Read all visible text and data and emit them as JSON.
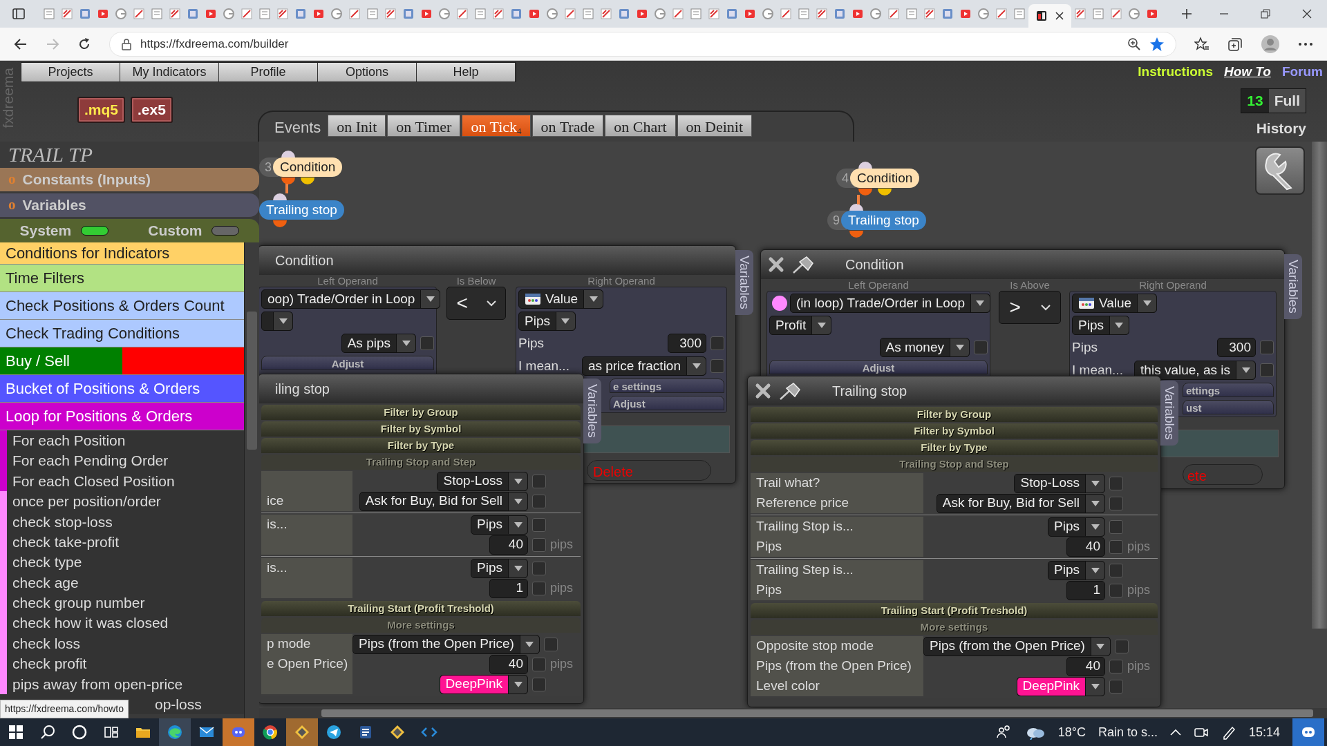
{
  "browser": {
    "url": "https://fxdreema.com/builder"
  },
  "logo": "fxdreema",
  "menu": [
    "Projects",
    "My Indicators",
    "Profile",
    "Options",
    "Help"
  ],
  "help_links": [
    {
      "label": "Instructions",
      "kind": "highlight"
    },
    {
      "label": "How To",
      "kind": "emphasis"
    },
    {
      "label": "Forum",
      "kind": "plain"
    }
  ],
  "export_buttons": [
    {
      "label": ".mq5",
      "kind": "source"
    },
    {
      "label": ".ex5",
      "kind": "compiled"
    }
  ],
  "events": {
    "label": "Events",
    "tabs": [
      {
        "label": "on Init",
        "selected": false
      },
      {
        "label": "on Timer",
        "selected": false
      },
      {
        "label": "on Tick",
        "selected": true,
        "count": "4"
      },
      {
        "label": "on Trade",
        "selected": false
      },
      {
        "label": "on Chart",
        "selected": false
      },
      {
        "label": "on Deinit",
        "selected": false
      }
    ]
  },
  "plan": {
    "count": "13",
    "label": "Full",
    "history": "History"
  },
  "project_title": "TRAIL TP",
  "sidebar": {
    "sections": [
      {
        "marker": "o",
        "label": "Constants (Inputs)",
        "color": "#9a7656"
      },
      {
        "marker": "o",
        "label": "Variables",
        "color": "#525264"
      }
    ],
    "toggles": [
      {
        "label": "System",
        "on": true
      },
      {
        "label": "Custom",
        "on": false
      }
    ],
    "categories": [
      {
        "label": "Conditions for Indicators",
        "color": "#ffd166"
      },
      {
        "label": "Time Filters",
        "color": "#b2e283"
      },
      {
        "label": "Check Positions & Orders Count",
        "color": "#adc9ff"
      },
      {
        "label": "Check Trading Conditions",
        "color": "#adc9ff"
      },
      {
        "label": "Buy / Sell",
        "color": "#008000",
        "sell": {
          "color": "#ff0000"
        }
      },
      {
        "label": "Bucket of Positions & Orders",
        "color": "#5555ff"
      },
      {
        "label": "Loop for Positions & Orders",
        "color": "#cc00cc"
      }
    ],
    "items": [
      {
        "label": "For each Position",
        "color": "#cc00cc"
      },
      {
        "label": "For each Pending Order",
        "color": "#cc00cc"
      },
      {
        "label": "For each Closed Position",
        "color": "#cc00cc"
      },
      {
        "label": "once per position/order",
        "color": "#ff88ff"
      },
      {
        "label": "check stop-loss",
        "color": "#ff88ff"
      },
      {
        "label": "check take-profit",
        "color": "#ff88ff"
      },
      {
        "label": "check type",
        "color": "#ff88ff"
      },
      {
        "label": "check age",
        "color": "#ff88ff"
      },
      {
        "label": "check group number",
        "color": "#ff88ff"
      },
      {
        "label": "check how it was closed",
        "color": "#ff88ff"
      },
      {
        "label": "check loss",
        "color": "#ff88ff"
      },
      {
        "label": "check profit",
        "color": "#ff88ff"
      },
      {
        "label": "pips away from open-price",
        "color": "#ff88ff"
      },
      {
        "label": "op-loss"
      }
    ]
  },
  "nodes": [
    {
      "number": "3",
      "label": "Condition",
      "kind": "condition"
    },
    {
      "label": "Trailing stop",
      "kind": "action"
    },
    {
      "number": "4",
      "label": "Condition",
      "kind": "condition"
    },
    {
      "number": "9",
      "label": "Trailing stop",
      "kind": "action"
    }
  ],
  "condition_windows": [
    {
      "title": "Condition",
      "controls": false,
      "left_label": "Left Operand",
      "operator_label": "Is Below",
      "right_label": "Right Operand",
      "source": {
        "text": "oop) Trade/Order in Loop"
      },
      "mode": "As pips",
      "mode_checked": false,
      "adjust": "Adjust",
      "operator": "<",
      "right_source": "Value",
      "unit": "Pips",
      "value_label": "Pips",
      "value": "300",
      "value_checked": false,
      "mean_label": "I mean...",
      "mean": "as price fraction",
      "mean_checked": false,
      "more_settings": "e settings",
      "right_adjust": "Adjust",
      "delete": "Delete",
      "variables_tab": "Variables"
    },
    {
      "title": "Condition",
      "controls": true,
      "left_label": "Left Operand",
      "operator_label": "Is Above",
      "right_label": "Right Operand",
      "source": {
        "text": "(in loop) Trade/Order in Loop",
        "color": "#ff88ff"
      },
      "field": "Profit",
      "mode": "As money",
      "mode_checked": false,
      "adjust": "Adjust",
      "operator": ">",
      "right_source": "Value",
      "unit": "Pips",
      "value_label": "Pips",
      "value": "300",
      "value_checked": false,
      "mean_label": "I mean...",
      "mean": "this value, as is",
      "mean_checked": false,
      "more_settings": "ettings",
      "right_adjust": "ust",
      "delete": "ete",
      "variables_tab": "Variables"
    }
  ],
  "trailing_windows": [
    {
      "title": "iling stop",
      "controls": false,
      "variables_tab": "Variables",
      "sections": [
        {
          "kind": "header",
          "text": "Filter by Group"
        },
        {
          "kind": "header",
          "text": "Filter by Symbol"
        },
        {
          "kind": "header",
          "text": "Filter by Type"
        },
        {
          "kind": "subheader",
          "text": "Trailing Stop and Step"
        },
        {
          "kind": "group",
          "rows": [
            {
              "select": "Stop-Loss",
              "checked": false
            },
            {
              "label": "ice",
              "select": "Ask for Buy, Bid for Sell",
              "checked": false
            }
          ]
        },
        {
          "kind": "group",
          "rows": [
            {
              "label": "is...",
              "select": "Pips",
              "checked": false
            },
            {
              "number": "40",
              "unit": "pips",
              "checked": false
            }
          ]
        },
        {
          "kind": "group",
          "rows": [
            {
              "label": "is...",
              "select": "Pips",
              "checked": false
            },
            {
              "number": "1",
              "unit": "pips",
              "checked": false
            }
          ]
        },
        {
          "kind": "header",
          "text": "Trailing Start (Profit Treshold)"
        },
        {
          "kind": "subheader",
          "text": "More settings"
        },
        {
          "kind": "group",
          "rows": [
            {
              "label": "p mode",
              "select": "Pips (from the Open Price)",
              "checked": false
            },
            {
              "label": "e Open Price)",
              "number": "40",
              "unit": "pips",
              "checked": false
            },
            {
              "select": "DeepPink",
              "color": "#ff1493",
              "checked": false
            }
          ]
        }
      ]
    },
    {
      "title": "Trailing stop",
      "controls": true,
      "variables_tab": "Variables",
      "sections": [
        {
          "kind": "header",
          "text": "Filter by Group"
        },
        {
          "kind": "header",
          "text": "Filter by Symbol"
        },
        {
          "kind": "header",
          "text": "Filter by Type"
        },
        {
          "kind": "subheader",
          "text": "Trailing Stop and Step"
        },
        {
          "kind": "group",
          "rows": [
            {
              "label": "Trail what?",
              "select": "Stop-Loss",
              "checked": false
            },
            {
              "label": "Reference price",
              "select": "Ask for Buy, Bid for Sell",
              "checked": false
            }
          ]
        },
        {
          "kind": "group",
          "rows": [
            {
              "label": "Trailing Stop is...",
              "select": "Pips",
              "checked": false
            },
            {
              "label": "Pips",
              "number": "40",
              "unit": "pips",
              "checked": false
            }
          ]
        },
        {
          "kind": "group",
          "rows": [
            {
              "label": "Trailing Step is...",
              "select": "Pips",
              "checked": false
            },
            {
              "label": "Pips",
              "number": "1",
              "unit": "pips",
              "checked": false
            }
          ]
        },
        {
          "kind": "header",
          "text": "Trailing Start (Profit Treshold)"
        },
        {
          "kind": "subheader",
          "text": "More settings"
        },
        {
          "kind": "group",
          "rows": [
            {
              "label": "Opposite stop mode",
              "select": "Pips (from the Open Price)",
              "checked": false
            },
            {
              "label": "Pips (from the Open Price)",
              "number": "40",
              "unit": "pips",
              "checked": false
            },
            {
              "label": "Level color",
              "select": "DeepPink",
              "color": "#ff1493",
              "checked": false
            }
          ]
        }
      ]
    }
  ],
  "status_url": "https://fxdreema.com/howto",
  "taskbar": {
    "temperature": "18°C",
    "forecast": "Rain to s...",
    "time": "15:14"
  }
}
